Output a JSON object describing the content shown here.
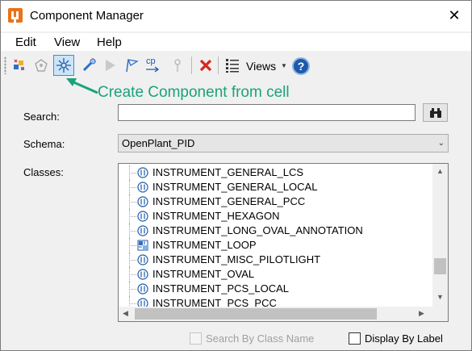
{
  "window": {
    "title": "Component Manager",
    "close_glyph": "✕"
  },
  "menu": {
    "items": [
      "Edit",
      "View",
      "Help"
    ]
  },
  "toolbar": {
    "views_label": "Views",
    "help_glyph": "?",
    "cp_label": "cp",
    "buttons": [
      "new-component-icon",
      "create-component-from-cell-icon",
      "create-component-from-cell-active-icon",
      "wand-tool-icon",
      "play-icon",
      "flag-icon",
      "copy-properties-icon",
      "pin-icon",
      "delete-icon",
      "list-view-icon",
      "help-icon"
    ]
  },
  "callout": {
    "text": "Create Component from cell",
    "color": "#1aa37a"
  },
  "form": {
    "search_label": "Search:",
    "search_value": "",
    "schema_label": "Schema:",
    "schema_value": "OpenPlant_PID",
    "classes_label": "Classes:"
  },
  "classes": [
    {
      "name": "INSTRUMENT_GENERAL_LCS",
      "icon": "instrument-class-icon"
    },
    {
      "name": "INSTRUMENT_GENERAL_LOCAL",
      "icon": "instrument-class-icon"
    },
    {
      "name": "INSTRUMENT_GENERAL_PCC",
      "icon": "instrument-class-icon"
    },
    {
      "name": "INSTRUMENT_HEXAGON",
      "icon": "instrument-class-icon"
    },
    {
      "name": "INSTRUMENT_LONG_OVAL_ANNOTATION",
      "icon": "instrument-class-icon"
    },
    {
      "name": "INSTRUMENT_LOOP",
      "icon": "loop-class-icon"
    },
    {
      "name": "INSTRUMENT_MISC_PILOTLIGHT",
      "icon": "instrument-class-icon"
    },
    {
      "name": "INSTRUMENT_OVAL",
      "icon": "instrument-class-icon"
    },
    {
      "name": "INSTRUMENT_PCS_LOCAL",
      "icon": "instrument-class-icon"
    },
    {
      "name": "INSTRUMENT_PCS_PCC",
      "icon": "instrument-class-icon"
    }
  ],
  "footer": {
    "search_by_class_name_label": "Search By Class Name",
    "search_by_class_name_checked": false,
    "search_by_class_name_enabled": false,
    "display_by_label_label": "Display By Label",
    "display_by_label_checked": false
  },
  "colors": {
    "accent": "#1aa37a",
    "selected_button_bg": "#cce4f7",
    "selected_button_border": "#3d8fd1",
    "delete_red": "#d9261c",
    "help_blue": "#1e5aa8"
  }
}
